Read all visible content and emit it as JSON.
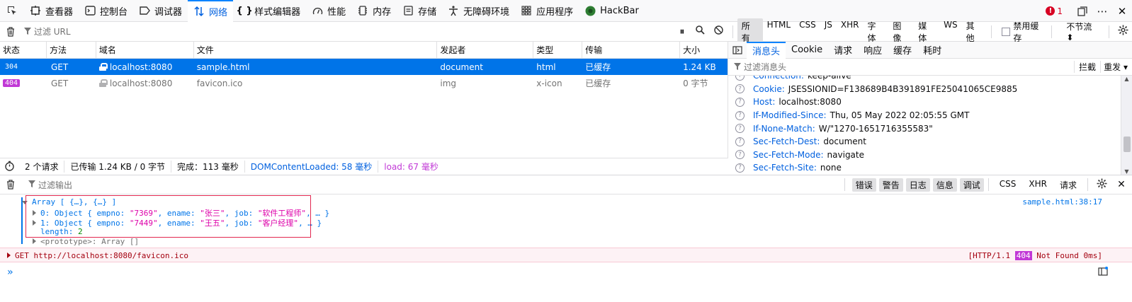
{
  "toolbar": {
    "tabs": [
      {
        "label": "查看器",
        "icon": "inspector-icon"
      },
      {
        "label": "控制台",
        "icon": "console-icon"
      },
      {
        "label": "调试器",
        "icon": "debugger-icon"
      },
      {
        "label": "网络",
        "icon": "network-icon"
      },
      {
        "label": "样式编辑器",
        "icon": "style-editor-icon"
      },
      {
        "label": "性能",
        "icon": "performance-icon"
      },
      {
        "label": "内存",
        "icon": "memory-icon"
      },
      {
        "label": "存储",
        "icon": "storage-icon"
      },
      {
        "label": "无障碍环境",
        "icon": "accessibility-icon"
      },
      {
        "label": "应用程序",
        "icon": "application-icon"
      },
      {
        "label": "HackBar",
        "icon": "hackbar-icon"
      }
    ],
    "error_count": "1"
  },
  "filter": {
    "placeholder": "过滤 URL",
    "types": [
      "所有",
      "HTML",
      "CSS",
      "JS",
      "XHR",
      "字体",
      "图像",
      "媒体",
      "WS",
      "其他"
    ],
    "disable_cache": "禁用缓存",
    "throttle": "不节流 ⬍"
  },
  "table": {
    "columns": [
      "状态",
      "方法",
      "域名",
      "文件",
      "发起者",
      "类型",
      "传输",
      "大小"
    ],
    "rows": [
      {
        "status": "304",
        "method": "GET",
        "domain": "localhost:8080",
        "file": "sample.html",
        "initiator": "document",
        "type": "html",
        "transfer": "已缓存",
        "size": "1.24 KB"
      },
      {
        "status": "404",
        "method": "GET",
        "domain": "localhost:8080",
        "file": "favicon.ico",
        "initiator": "img",
        "type": "x-icon",
        "transfer": "已缓存",
        "size": "0 字节"
      }
    ]
  },
  "status": {
    "requests": "2 个请求",
    "transferred": "已传输 1.24 KB / 0 字节",
    "finish": "完成：113 毫秒",
    "dcl": "DOMContentLoaded: 58 毫秒",
    "load": "load: 67 毫秒"
  },
  "side": {
    "tabs": [
      "消息头",
      "Cookie",
      "请求",
      "响应",
      "缓存",
      "耗时"
    ],
    "filter_placeholder": "过滤消息头",
    "block": "拦截",
    "resend": "重发 ▾",
    "headers": [
      {
        "name": "Connection:",
        "value": "keep-alive"
      },
      {
        "name": "Cookie:",
        "value": "JSESSIONID=F138689B4B391891FE25041065CE9885"
      },
      {
        "name": "Host:",
        "value": "localhost:8080"
      },
      {
        "name": "If-Modified-Since:",
        "value": "Thu, 05 May 2022 02:05:55 GMT"
      },
      {
        "name": "If-None-Match:",
        "value": "W/\"1270-1651716355583\""
      },
      {
        "name": "Sec-Fetch-Dest:",
        "value": "document"
      },
      {
        "name": "Sec-Fetch-Mode:",
        "value": "navigate"
      },
      {
        "name": "Sec-Fetch-Site:",
        "value": "none"
      }
    ]
  },
  "console": {
    "filter_placeholder": "过滤输出",
    "levels": [
      "错误",
      "警告",
      "日志",
      "信息",
      "调试"
    ],
    "extras": [
      "CSS",
      "XHR",
      "请求"
    ],
    "array_line": "Array [ {…}, {…} ]",
    "source": "sample.html:38:17",
    "item0_key": "0:",
    "item0_obj": "Object { empno: ",
    "item0_empno": "\"7369\"",
    "item0_ename_key": ", ename: ",
    "item0_ename": "\"张三\"",
    "item0_job_key": ", job: ",
    "item0_job": "\"软件工程师\"",
    "item0_tail": ", … }",
    "item1_key": "1:",
    "item1_obj": "Object { empno: ",
    "item1_empno": "\"7449\"",
    "item1_ename_key": ", ename: ",
    "item1_ename": "\"王五\"",
    "item1_job_key": ", job: ",
    "item1_job": "\"客户经理\"",
    "item1_tail": ", … }",
    "length_key": "length:",
    "length_val": "2",
    "proto": "<prototype>: Array []",
    "err_text": "GET http://localhost:8080/favicon.ico",
    "err_http": "[HTTP/1.1 ",
    "err_code": "404",
    "err_tail": " Not Found 0ms]",
    "prompt": "»"
  }
}
